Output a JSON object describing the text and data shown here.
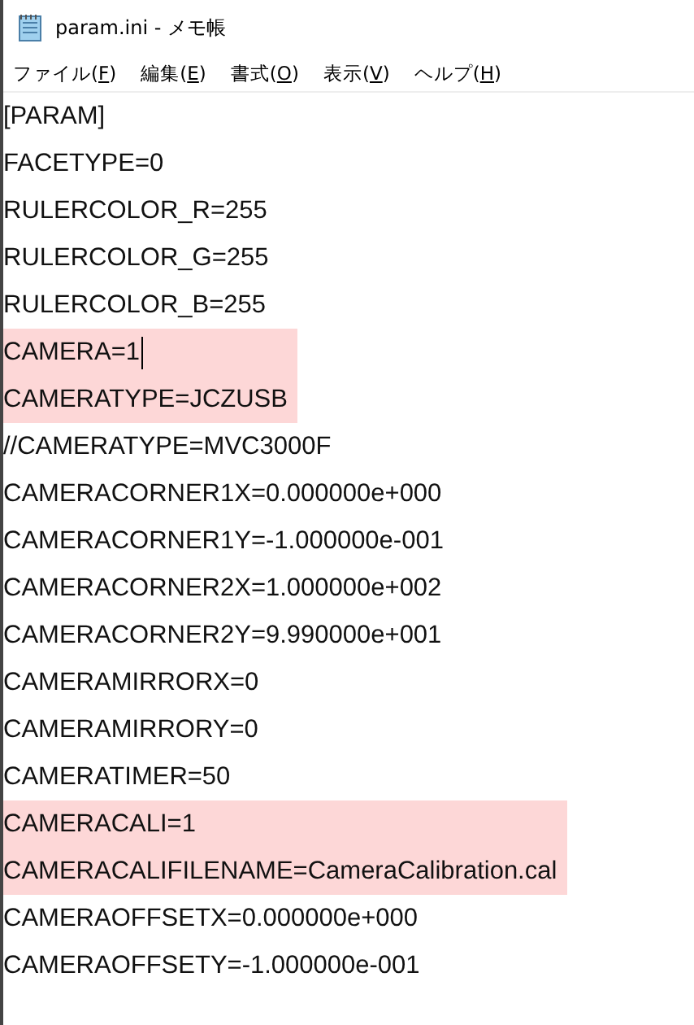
{
  "window": {
    "title": "param.ini - メモ帳"
  },
  "menu": [
    {
      "text": "ファイル(",
      "key": "F",
      "tail": ")"
    },
    {
      "text": "編集(",
      "key": "E",
      "tail": ")"
    },
    {
      "text": "書式(",
      "key": "O",
      "tail": ")"
    },
    {
      "text": "表示(",
      "key": "V",
      "tail": ")"
    },
    {
      "text": "ヘルプ(",
      "key": "H",
      "tail": ")"
    }
  ],
  "lines": [
    {
      "text": "[PARAM]",
      "highlighted": false
    },
    {
      "text": "FACETYPE=0",
      "highlighted": false
    },
    {
      "text": "RULERCOLOR_R=255",
      "highlighted": false
    },
    {
      "text": "RULERCOLOR_G=255",
      "highlighted": false
    },
    {
      "text": "RULERCOLOR_B=255",
      "highlighted": false
    },
    {
      "text": "CAMERA=1",
      "highlighted": true,
      "cursor": true
    },
    {
      "text": "CAMERATYPE=JCZUSB",
      "highlighted": true
    },
    {
      "text": "//CAMERATYPE=MVC3000F",
      "highlighted": false
    },
    {
      "text": "CAMERACORNER1X=0.000000e+000",
      "highlighted": false
    },
    {
      "text": "CAMERACORNER1Y=-1.000000e-001",
      "highlighted": false
    },
    {
      "text": "CAMERACORNER2X=1.000000e+002",
      "highlighted": false
    },
    {
      "text": "CAMERACORNER2Y=9.990000e+001",
      "highlighted": false
    },
    {
      "text": "CAMERAMIRRORX=0",
      "highlighted": false
    },
    {
      "text": "CAMERAMIRRORY=0",
      "highlighted": false
    },
    {
      "text": "CAMERATIMER=50",
      "highlighted": false
    },
    {
      "text": "CAMERACALI=1",
      "highlighted": true
    },
    {
      "text": "CAMERACALIFILENAME=CameraCalibration.cal",
      "highlighted": true
    },
    {
      "text": "CAMERAOFFSETX=0.000000e+000",
      "highlighted": false
    },
    {
      "text": "CAMERAOFFSETY=-1.000000e-001",
      "highlighted": false
    }
  ]
}
